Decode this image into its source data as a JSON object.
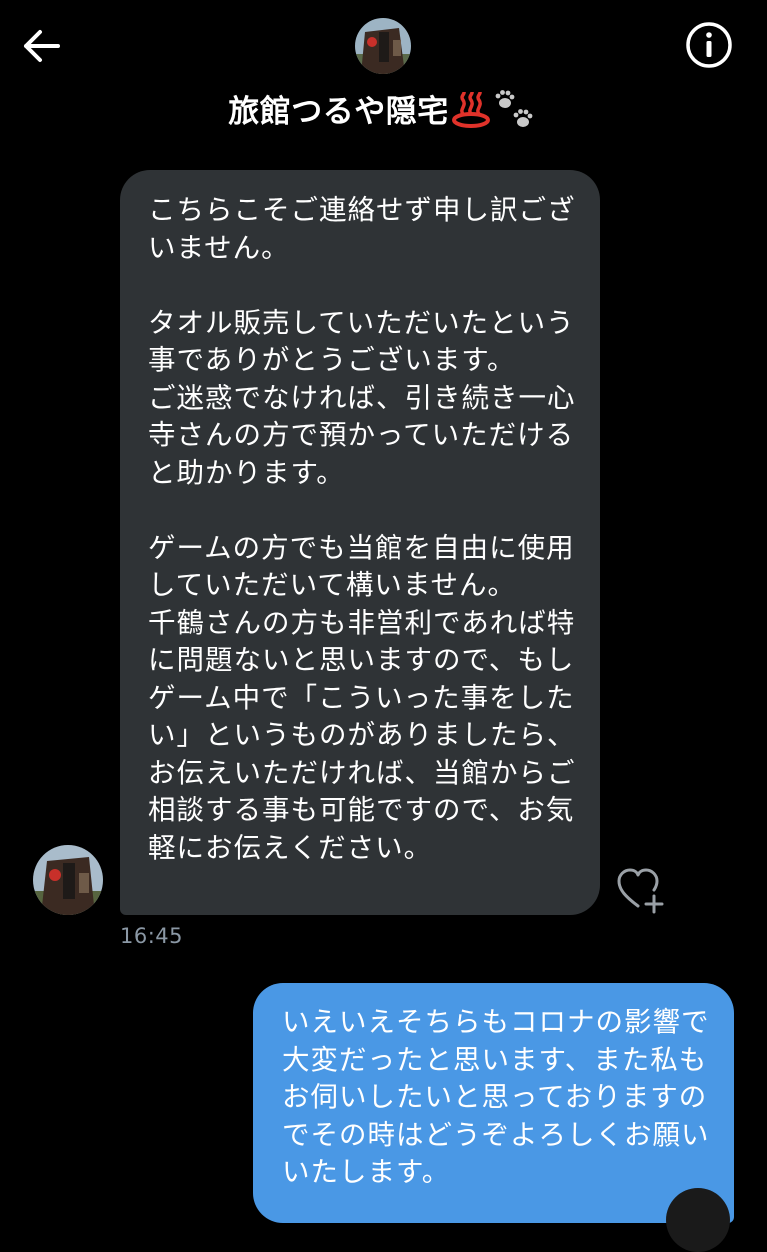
{
  "header": {
    "title": "旅館つるや隠宅",
    "title_emoji_names": [
      "hot-springs-emoji",
      "paw-prints-emoji"
    ],
    "back_icon": "arrow-left-icon",
    "info_icon": "info-icon"
  },
  "messages": [
    {
      "direction": "incoming",
      "text": "こちらこそご連絡せず申し訳ございません。\n\nタオル販売していただいたという事でありがとうございます。\nご迷惑でなければ、引き続き一心寺さんの方で預かっていただけると助かります。\n\nゲームの方でも当館を自由に使用していただいて構いません。\n千鶴さんの方も非営利であれば特に問題ないと思いますので、もしゲーム中で「こういった事をしたい」というものがありましたら、お伝えいただければ、当館からご相談する事も可能ですので、お気軽にお伝えください。",
      "time": "16:45",
      "reaction_icon": "heart-plus-icon"
    },
    {
      "direction": "outgoing",
      "text": "いえいえそちらもコロナの影響で大変だったと思います、また私もお伺いしたいと思っておりますのでその時はどうぞよろしくお願いいたします。"
    }
  ],
  "colors": {
    "background": "#000000",
    "incoming_bubble": "#2f3336",
    "outgoing_bubble": "#4a98e5",
    "timestamp": "#8b98a5"
  }
}
